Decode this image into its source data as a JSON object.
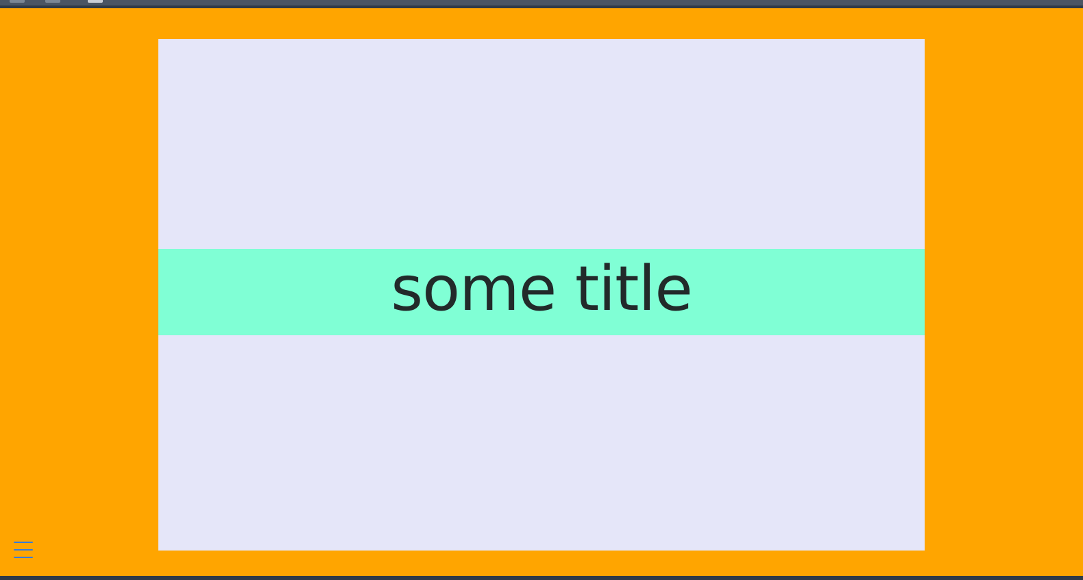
{
  "slide": {
    "title": "some title"
  },
  "menu": {
    "icon": "hamburger-menu-icon"
  },
  "colors": {
    "page_background": "#ffa500",
    "slide_background": "#e5e6f9",
    "title_band_background": "#80ffd5",
    "title_text": "#222a2a",
    "menu_icon": "#3a7bd5"
  }
}
